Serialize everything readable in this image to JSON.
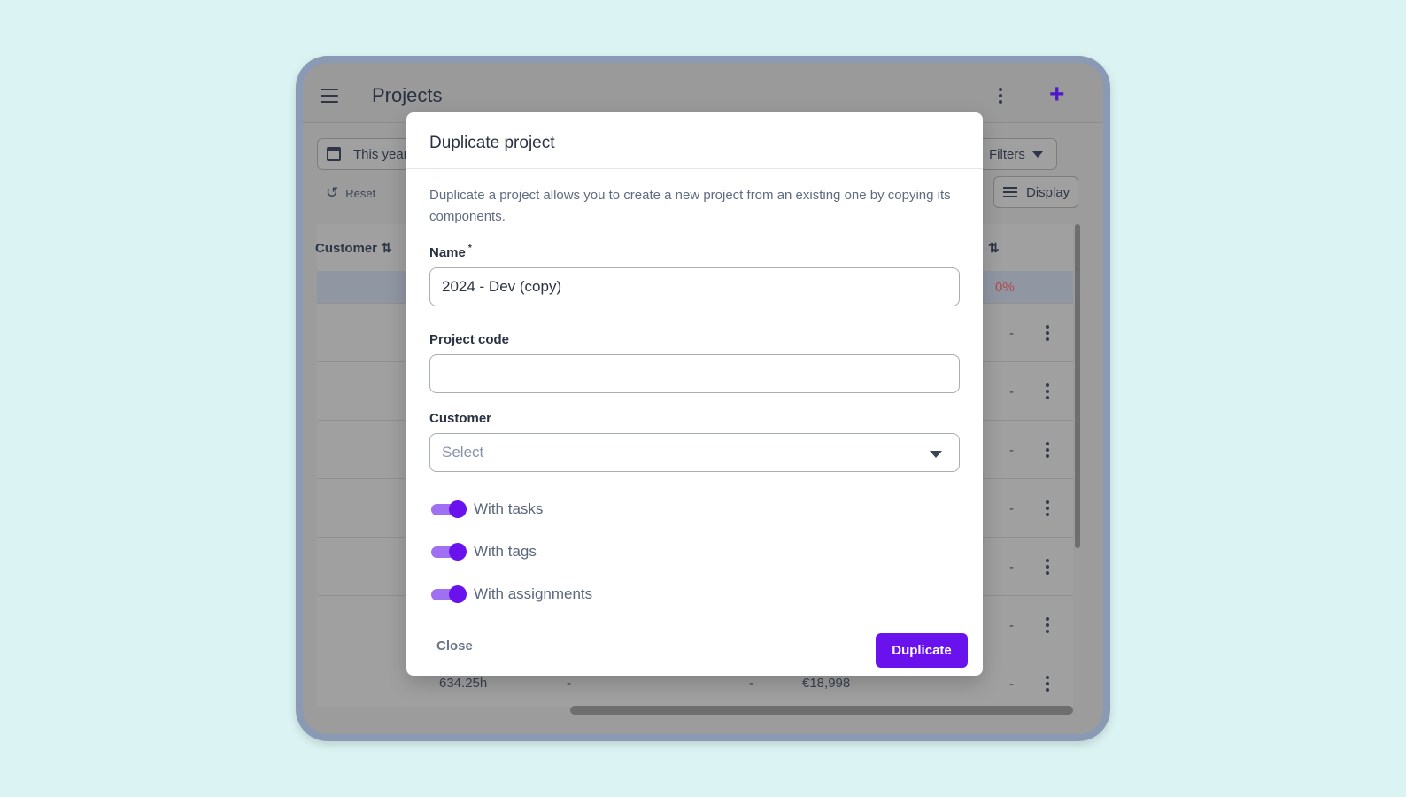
{
  "app": {
    "title": "Projects"
  },
  "filters": {
    "period": "This year",
    "filters_label": "Filters",
    "reset_label": "Reset",
    "display_label": "Display"
  },
  "table": {
    "columns": [
      "Customer"
    ],
    "highlight_value": "0%",
    "row_dash": "-",
    "last_row": {
      "hours": "634.25h",
      "col2": "-",
      "col3": "-",
      "amount": "€18,998"
    }
  },
  "modal": {
    "title": "Duplicate project",
    "description": "Duplicate a project allows you to create a new project from an existing one by copying its components.",
    "name_label": "Name",
    "required_mark": "*",
    "name_value": "2024 - Dev (copy)",
    "code_label": "Project code",
    "code_value": "",
    "customer_label": "Customer",
    "customer_placeholder": "Select",
    "toggles": [
      {
        "label": "With tasks",
        "on": true
      },
      {
        "label": "With tags",
        "on": true
      },
      {
        "label": "With assignments",
        "on": true
      }
    ],
    "close_label": "Close",
    "duplicate_label": "Duplicate"
  },
  "colors": {
    "accent": "#6a12ee",
    "accent_light": "#a070f2",
    "background": "#dbf4f3"
  }
}
